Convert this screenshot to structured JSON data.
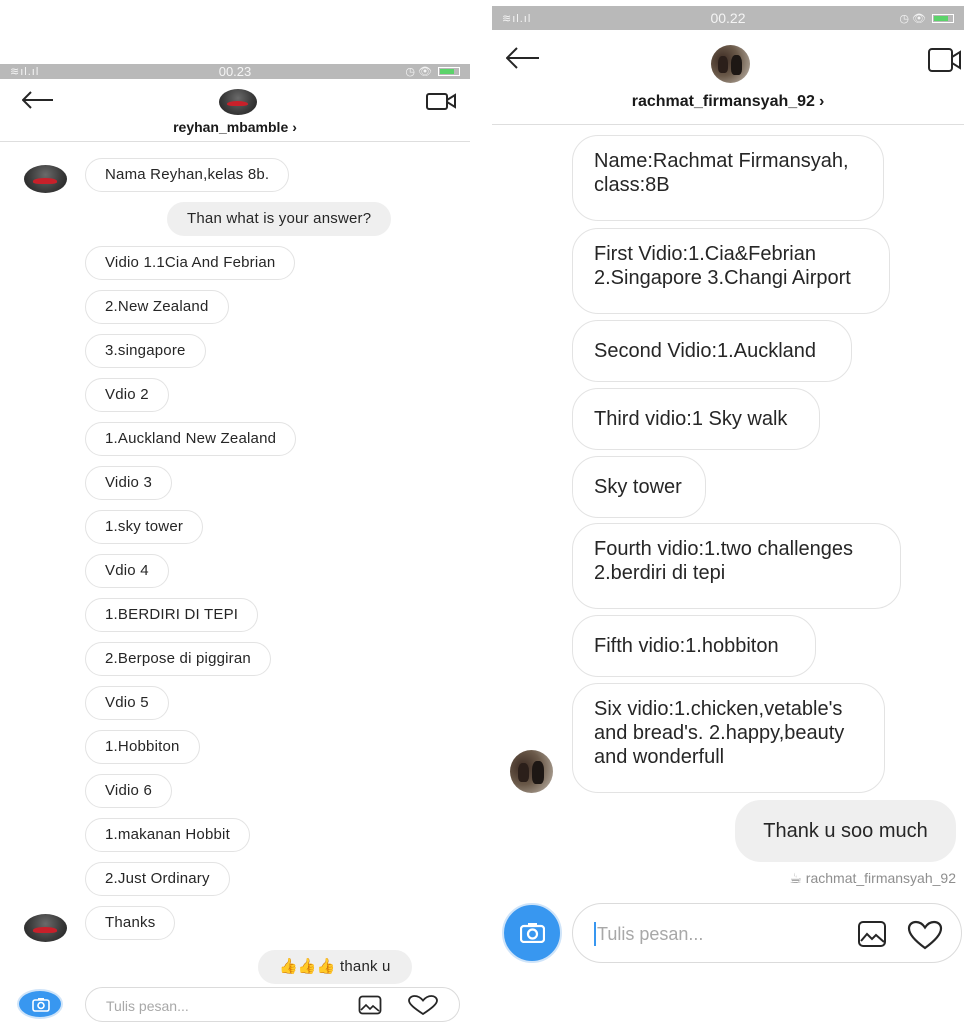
{
  "left": {
    "status": {
      "signal": "≋ıl.ıl",
      "time": "00.23",
      "icons": "◷ 👁"
    },
    "header": {
      "username": "reyhan_mbamble",
      "chevron": "›"
    },
    "messages": [
      {
        "text": "Nama Reyhan,kelas 8b.",
        "dir": "in"
      },
      {
        "text": "Than what is your answer?",
        "dir": "out"
      },
      {
        "text": "Vidio 1.1Cia And Febrian",
        "dir": "in"
      },
      {
        "text": "2.New Zealand",
        "dir": "in"
      },
      {
        "text": "3.singapore",
        "dir": "in"
      },
      {
        "text": "Vdio 2",
        "dir": "in"
      },
      {
        "text": "1.Auckland New Zealand",
        "dir": "in"
      },
      {
        "text": "Vidio 3",
        "dir": "in"
      },
      {
        "text": "1.sky tower",
        "dir": "in"
      },
      {
        "text": "Vdio 4",
        "dir": "in"
      },
      {
        "text": "1.BERDIRI DI TEPI",
        "dir": "in"
      },
      {
        "text": "2.Berpose di piggiran",
        "dir": "in"
      },
      {
        "text": "Vdio 5",
        "dir": "in"
      },
      {
        "text": "1.Hobbiton",
        "dir": "in"
      },
      {
        "text": "Vidio 6",
        "dir": "in"
      },
      {
        "text": "1.makanan Hobbit",
        "dir": "in"
      },
      {
        "text": "2.Just Ordinary",
        "dir": "in"
      },
      {
        "text": "Thanks",
        "dir": "in"
      },
      {
        "text": "👍👍👍 thank u",
        "dir": "out"
      }
    ],
    "composer": {
      "placeholder": "Tulis pesan..."
    }
  },
  "right": {
    "status": {
      "signal": "≋ıl.ıl",
      "time": "00.22",
      "icons": "◷ 👁"
    },
    "header": {
      "username": "rachmat_firmansyah_92",
      "chevron": "›"
    },
    "messages": [
      {
        "text": "Name:Rachmat Firmansyah, class:8B",
        "dir": "in"
      },
      {
        "text": "First Vidio:1.Cia&Febrian 2.Singapore 3.Changi Airport",
        "dir": "in"
      },
      {
        "text": "Second Vidio:1.Auckland",
        "dir": "in"
      },
      {
        "text": "Third vidio:1 Sky walk",
        "dir": "in"
      },
      {
        "text": "Sky tower",
        "dir": "in"
      },
      {
        "text": "Fourth vidio:1.two challenges 2.berdiri di tepi",
        "dir": "in"
      },
      {
        "text": "Fifth vidio:1.hobbiton",
        "dir": "in"
      },
      {
        "text": "Six vidio:1.chicken,vetable's and bread's. 2.happy,beauty and wonderfull",
        "dir": "in"
      },
      {
        "text": "Thank u soo much",
        "dir": "out"
      }
    ],
    "seen": "☕ rachmat_firmansyah_92",
    "composer": {
      "placeholder": "Tulis pesan..."
    }
  },
  "colors": {
    "accent": "#3897f0",
    "statusbar": "#b9b9b9",
    "outgoing": "#efefef",
    "border": "#e3e3e3"
  }
}
